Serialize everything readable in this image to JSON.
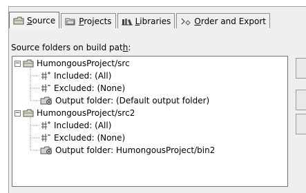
{
  "tabs": [
    {
      "label": "Source",
      "mnemonic_index": 0,
      "icon": "source-folder-icon",
      "active": true
    },
    {
      "label": "Projects",
      "mnemonic_index": 0,
      "icon": "projects-icon",
      "active": false
    },
    {
      "label": "Libraries",
      "mnemonic_index": 0,
      "icon": "libraries-icon",
      "active": false
    },
    {
      "label": "Order and Export",
      "mnemonic_index": 0,
      "icon": "order-export-icon",
      "active": false
    }
  ],
  "caption": {
    "prefix": "Source folders on build pat",
    "mnemonic": "h",
    "suffix": ":"
  },
  "tree": [
    {
      "label": "HumongousProject/src",
      "icon": "source-folder-icon",
      "expander": "-",
      "children": [
        {
          "label": "Included: (All)",
          "icon": "inclusion-filter-icon"
        },
        {
          "label": "Excluded: (None)",
          "icon": "exclusion-filter-icon"
        },
        {
          "label": "Output folder: (Default output folder)",
          "icon": "output-folder-icon"
        }
      ]
    },
    {
      "label": "HumongousProject/src2",
      "icon": "source-folder-icon",
      "expander": "-",
      "children": [
        {
          "label": "Included: (All)",
          "icon": "inclusion-filter-icon"
        },
        {
          "label": "Excluded: (None)",
          "icon": "exclusion-filter-icon"
        },
        {
          "label": "Output folder: HumongousProject/bin2",
          "icon": "output-folder-icon"
        }
      ]
    }
  ]
}
